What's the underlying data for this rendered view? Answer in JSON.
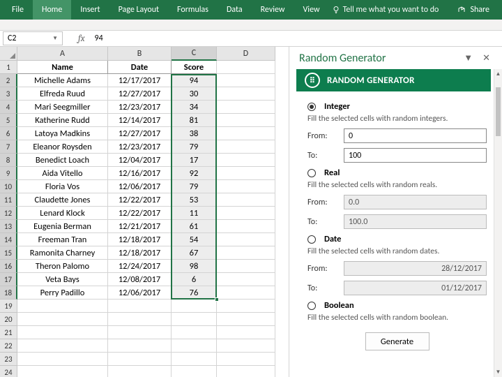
{
  "ribbon": {
    "tabs": [
      "File",
      "Home",
      "Insert",
      "Page Layout",
      "Formulas",
      "Data",
      "Review",
      "View"
    ],
    "tell": "Tell me what you want to do",
    "share": "Share"
  },
  "formula_bar": {
    "cell_ref": "C2",
    "value": "94",
    "fx": "fx"
  },
  "columns": [
    "A",
    "B",
    "C",
    "D"
  ],
  "headers": {
    "name": "Name",
    "date": "Date",
    "score": "Score"
  },
  "rows": [
    {
      "n": "Michelle Adams",
      "d": "12/17/2017",
      "s": "94"
    },
    {
      "n": "Elfreda Ruud",
      "d": "12/27/2017",
      "s": "30"
    },
    {
      "n": "Mari Seegmiller",
      "d": "12/23/2017",
      "s": "34"
    },
    {
      "n": "Katherine Rudd",
      "d": "12/14/2017",
      "s": "81"
    },
    {
      "n": "Latoya Madkins",
      "d": "12/27/2017",
      "s": "38"
    },
    {
      "n": "Eleanor Roysden",
      "d": "12/23/2017",
      "s": "79"
    },
    {
      "n": "Benedict Loach",
      "d": "12/04/2017",
      "s": "17"
    },
    {
      "n": "Aida Vitello",
      "d": "12/16/2017",
      "s": "92"
    },
    {
      "n": "Floria Vos",
      "d": "12/06/2017",
      "s": "79"
    },
    {
      "n": "Claudette Jones",
      "d": "12/22/2017",
      "s": "53"
    },
    {
      "n": "Lenard Klock",
      "d": "12/22/2017",
      "s": "11"
    },
    {
      "n": "Eugenia Berman",
      "d": "12/21/2017",
      "s": "61"
    },
    {
      "n": "Freeman Tran",
      "d": "12/18/2017",
      "s": "54"
    },
    {
      "n": "Ramonita Charney",
      "d": "12/18/2017",
      "s": "67"
    },
    {
      "n": "Theron Palomo",
      "d": "12/24/2017",
      "s": "98"
    },
    {
      "n": "Veta Bays",
      "d": "12/08/2017",
      "s": "6"
    },
    {
      "n": "Perry Padillo",
      "d": "12/06/2017",
      "s": "76"
    }
  ],
  "empty_rows": [
    "19",
    "20",
    "21",
    "22",
    "23",
    "24"
  ],
  "panel": {
    "title": "Random Generator",
    "banner": "RANDOM GENERATOR",
    "integer": {
      "label": "Integer",
      "desc": "Fill the selected cells with random integers.",
      "from_lbl": "From:",
      "to_lbl": "To:",
      "from": "0",
      "to": "100"
    },
    "real": {
      "label": "Real",
      "desc": "Fill the selected cells with random reals.",
      "from_lbl": "From:",
      "to_lbl": "To:",
      "from": "0.0",
      "to": "100.0"
    },
    "date": {
      "label": "Date",
      "desc": "Fill the selected cells with random dates.",
      "from_lbl": "From:",
      "to_lbl": "To:",
      "from": "28/12/2017",
      "to": "01/12/2017"
    },
    "boolean": {
      "label": "Boolean",
      "desc": "Fill the selected cells with random boolean."
    },
    "generate": "Generate"
  }
}
